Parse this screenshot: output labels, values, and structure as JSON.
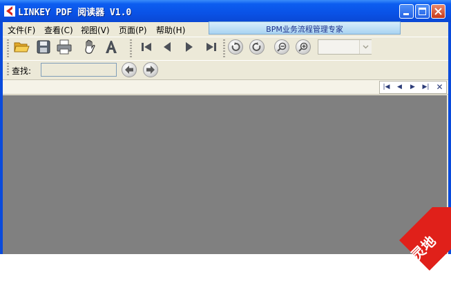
{
  "window": {
    "title": "LINKEY PDF 阅读器 V1.0"
  },
  "menu": [
    "文件(F)",
    "查看(C)",
    "视图(V)",
    "页面(P)",
    "帮助(H)"
  ],
  "banner": "BPM业务流程管理专家",
  "toolbar": {
    "buttons": [
      "open-folder-icon",
      "save-icon",
      "print-icon",
      "hand-tool-icon",
      "text-select-icon",
      "first-page-icon",
      "previous-page-icon",
      "next-page-icon",
      "last-page-icon",
      "rotate-left-icon",
      "rotate-right-icon",
      "zoom-out-icon",
      "zoom-in-icon"
    ],
    "zoom_value": ""
  },
  "find": {
    "label": "查找:",
    "value": ""
  },
  "corner_badge_text": "灵地",
  "colors": {
    "title_bar": "#0a52e6",
    "document_bg": "#808080",
    "chrome_bg": "#ece9d8",
    "corner_badge": "#e0201a"
  }
}
